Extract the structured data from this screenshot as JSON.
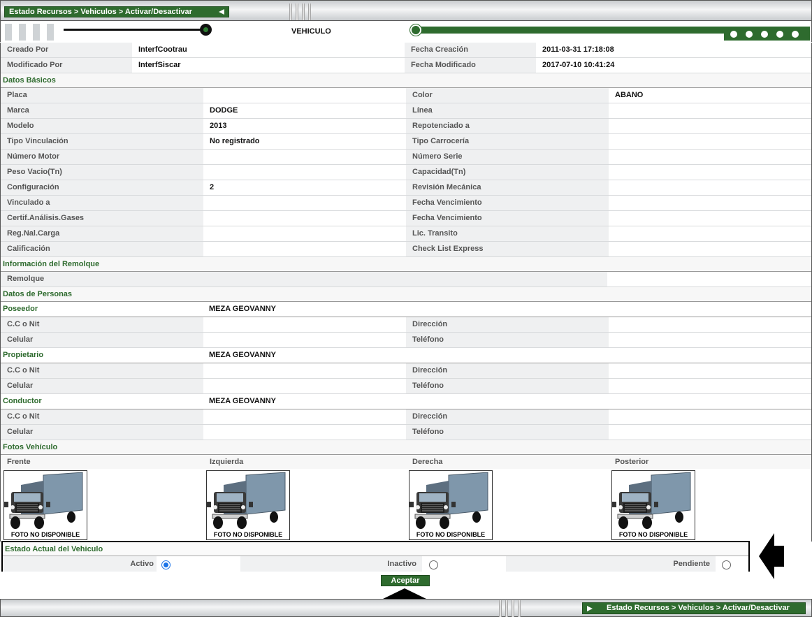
{
  "breadcrumb": "Estado Recursos > Vehiculos > Activar/Desactivar",
  "header": {
    "title": "VEHICULO"
  },
  "audit": {
    "created_by_label": "Creado Por",
    "created_by": "InterfCootrau",
    "created_date_label": "Fecha Creación",
    "created_date": "2011-03-31 17:18:08",
    "modified_by_label": "Modificado Por",
    "modified_by": "InterfSiscar",
    "modified_date_label": "Fecha Modificado",
    "modified_date": "2017-07-10 10:41:24"
  },
  "basic": {
    "title": "Datos Básicos",
    "rows": [
      [
        "Placa",
        "",
        "Color",
        "ABANO"
      ],
      [
        "Marca",
        "DODGE",
        "Línea",
        ""
      ],
      [
        "Modelo",
        "2013",
        "Repotenciado a",
        ""
      ],
      [
        "Tipo Vinculación",
        "No registrado",
        "Tipo Carrocería",
        ""
      ],
      [
        "Número Motor",
        "",
        "Número Serie",
        ""
      ],
      [
        "Peso Vacio(Tn)",
        "",
        "Capacidad(Tn)",
        ""
      ],
      [
        "Configuración",
        "2",
        "Revisión Mecánica",
        ""
      ],
      [
        "Vinculado a",
        "",
        "Fecha Vencimiento",
        ""
      ],
      [
        "Certif.Análisis.Gases",
        "",
        "Fecha Vencimiento",
        ""
      ],
      [
        "Reg.Nal.Carga",
        "",
        "Lic. Transito",
        ""
      ],
      [
        "Calificación",
        "",
        "Check List Express",
        ""
      ]
    ]
  },
  "trailer": {
    "title": "Información del Remolque",
    "label": "Remolque",
    "value": ""
  },
  "people": {
    "title": "Datos de Personas",
    "groups": [
      {
        "role": "Poseedor",
        "name": "MEZA GEOVANNY",
        "id_label": "C.C o Nit",
        "id": "",
        "address_label": "Dirección",
        "address": "",
        "cell_label": "Celular",
        "cell": "",
        "phone_label": "Teléfono",
        "phone": ""
      },
      {
        "role": "Propietario",
        "name": "MEZA GEOVANNY",
        "id_label": "C.C o Nit",
        "id": "",
        "address_label": "Dirección",
        "address": "",
        "cell_label": "Celular",
        "cell": "",
        "phone_label": "Teléfono",
        "phone": ""
      },
      {
        "role": "Conductor",
        "name": "MEZA GEOVANNY",
        "id_label": "C.C o Nit",
        "id": "",
        "address_label": "Dirección",
        "address": "",
        "cell_label": "Celular",
        "cell": "",
        "phone_label": "Teléfono",
        "phone": ""
      }
    ]
  },
  "photos": {
    "title": "Fotos Vehículo",
    "labels": [
      "Frente",
      "Izquierda",
      "Derecha",
      "Posterior"
    ],
    "placeholder_text": "FOTO NO DISPONIBLE"
  },
  "status": {
    "title": "Estado Actual del Vehiculo",
    "options": [
      "Activo",
      "Inactivo",
      "Pendiente"
    ],
    "selected": "Activo"
  },
  "accept_label": "Aceptar",
  "colors": {
    "brand_green": "#2e6b2e",
    "label_bg": "#eff0f1",
    "section_text": "#2e6b2e"
  }
}
